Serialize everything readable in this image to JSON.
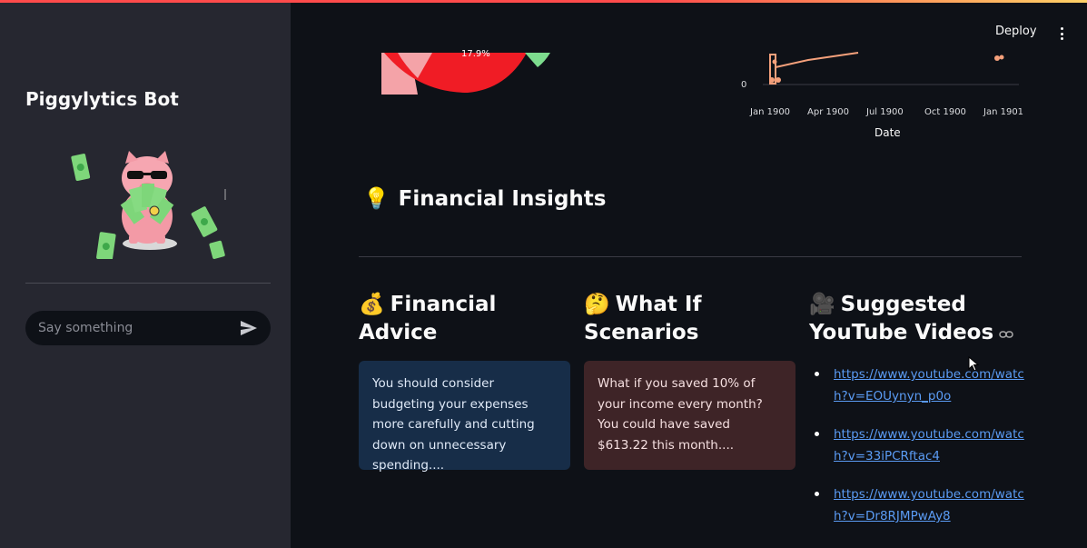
{
  "app": {
    "title": "Piggylytics Bot",
    "deploy_label": "Deploy"
  },
  "sidebar": {
    "chat_placeholder": "Say something"
  },
  "chart_fragments": {
    "pie_label": "17.9%",
    "y_tick": "0",
    "x_ticks": [
      "Jan 1900",
      "Apr 1900",
      "Jul 1900",
      "Oct 1900",
      "Jan 1901"
    ],
    "x_title": "Date"
  },
  "insights": {
    "title": "Financial Insights",
    "title_emoji": "💡",
    "columns": [
      {
        "emoji": "💰",
        "title_line1": "Financial",
        "title_line2": "Advice",
        "text": "You should consider budgeting your expenses more carefully and cutting down on unnecessary spending...."
      },
      {
        "emoji": "🤔",
        "title_line1": "What If",
        "title_line2": "Scenarios",
        "text": "What if you saved 10% of your income every month? You could have saved $613.22 this month...."
      },
      {
        "emoji": "🎥",
        "title_line1": "Suggested",
        "title_line2": "YouTube Videos"
      }
    ],
    "videos": [
      "https://www.youtube.com/watch?v=EOUynyn_p0o",
      "https://www.youtube.com/watch?v=33iPCRftac4",
      "https://www.youtube.com/watch?v=Dr8RJMPwAy8"
    ]
  },
  "colors": {
    "accent": "#ff4b4b",
    "sidebar_bg": "#262730",
    "main_bg": "#0e1117",
    "link": "#5b9cf5",
    "advice_card": "#172d48",
    "whatif_card": "#3e2427"
  }
}
